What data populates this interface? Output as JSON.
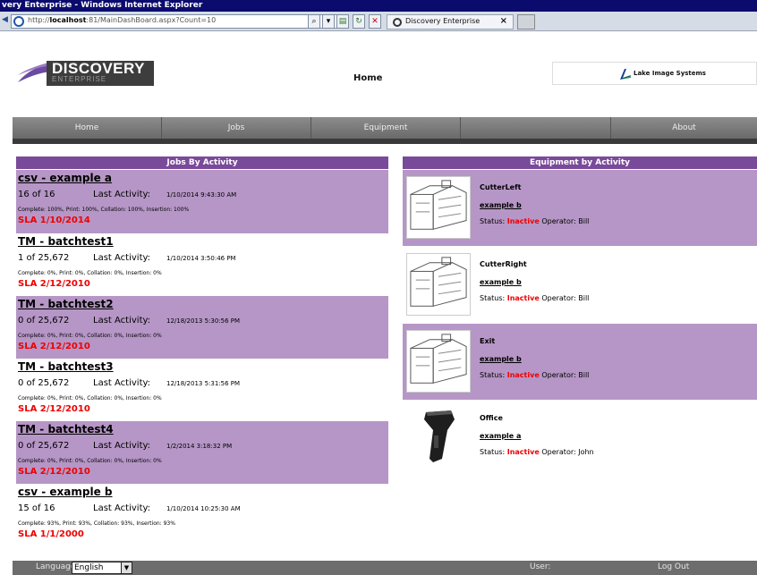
{
  "browser": {
    "window_title": "very Enterprise - Windows Internet Explorer",
    "address_host": "localhost",
    "address_prefix": "http://",
    "address_suffix": ":81/MainDashBoard.aspx?Count=10",
    "tab_title": "Discovery Enterprise",
    "tab_close": "×"
  },
  "header": {
    "logo_name": "DISCOVERY",
    "logo_sub": "ENTERPRISE",
    "page_title": "Home",
    "partner_name": "Lake Image Systems"
  },
  "nav": {
    "items": [
      "Home",
      "Jobs",
      "Equipment",
      "",
      "About"
    ]
  },
  "jobs_panel": {
    "title": "Jobs By Activity",
    "last_activity_label": "Last Activity:",
    "jobs": [
      {
        "name": "csv - example a",
        "count": "16 of 16",
        "last_activity": "1/10/2014 9:43:30 AM",
        "progress": "Complete: 100%, Print: 100%, Collation: 100%, Insertion: 100%",
        "sla": "SLA 1/10/2014"
      },
      {
        "name": "TM - batchtest1",
        "count": "1 of 25,672",
        "last_activity": "1/10/2014 3:50:46 PM",
        "progress": "Complete: 0%, Print: 0%, Collation: 0%, Insertion: 0%",
        "sla": "SLA 2/12/2010"
      },
      {
        "name": "TM - batchtest2",
        "count": "0 of 25,672",
        "last_activity": "12/18/2013 5:30:56 PM",
        "progress": "Complete: 0%, Print: 0%, Collation: 0%, Insertion: 0%",
        "sla": "SLA 2/12/2010"
      },
      {
        "name": "TM - batchtest3",
        "count": "0 of 25,672",
        "last_activity": "12/18/2013 5:31:56 PM",
        "progress": "Complete: 0%, Print: 0%, Collation: 0%, Insertion: 0%",
        "sla": "SLA 2/12/2010"
      },
      {
        "name": "TM - batchtest4",
        "count": "0 of 25,672",
        "last_activity": "1/2/2014 3:18:32 PM",
        "progress": "Complete: 0%, Print: 0%, Collation: 0%, Insertion: 0%",
        "sla": "SLA 2/12/2010"
      },
      {
        "name": "csv - example b",
        "count": "15 of 16",
        "last_activity": "1/10/2014 10:25:30 AM",
        "progress": "Complete: 93%, Print: 93%, Collation: 93%, Insertion: 93%",
        "sla": "SLA 1/1/2000"
      }
    ]
  },
  "equipment_panel": {
    "title": "Equipment by Activity",
    "status_label": "Status:",
    "operator_label": "Operator:",
    "items": [
      {
        "name": "CutterLeft",
        "job": "example b",
        "status": "Inactive",
        "operator": "Bill",
        "icon": "machine-icon"
      },
      {
        "name": "CutterRight",
        "job": "example b",
        "status": "Inactive",
        "operator": "Bill",
        "icon": "machine-icon"
      },
      {
        "name": "Exit",
        "job": "example b",
        "status": "Inactive",
        "operator": "Bill",
        "icon": "machine-icon"
      },
      {
        "name": "Office",
        "job": "example a",
        "status": "Inactive",
        "operator": "John",
        "icon": "barcode-scanner-icon"
      }
    ]
  },
  "footer": {
    "language_label": "Language:",
    "language_value": "English",
    "user_label": "User:",
    "logout_label": "Log Out"
  },
  "colors": {
    "accent_purple": "#7a4a9a",
    "row_purple": "#b696c6",
    "sla_red": "#ee0000",
    "nav_gray": "#7b7b7b"
  }
}
